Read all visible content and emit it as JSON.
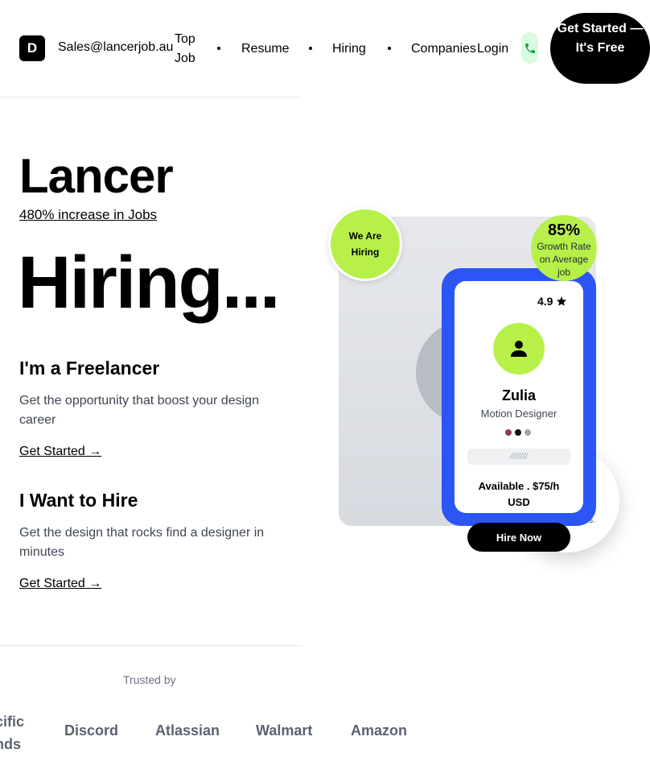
{
  "header": {
    "logo_letter": "D",
    "email": "Sales@lancerjob.au",
    "nav": [
      "Top Job",
      "Resume",
      "Hiring",
      "Companies"
    ],
    "login": "Login",
    "cta": "Get Started — It's Free"
  },
  "hero": {
    "title": "Lancer",
    "link": "480% increase in Jobs",
    "hiring": "Hiring..."
  },
  "blocks": [
    {
      "title": "I'm a Freelancer",
      "desc": "Get the opportunity that boost your design career",
      "link": "Get Started →"
    },
    {
      "title": "I Want to Hire",
      "desc": "Get the design that rocks find a designer in minutes",
      "link": "Get Started →"
    }
  ],
  "trusted": {
    "label": "Trusted by",
    "brands": [
      "cific nds",
      "Discord",
      "Atlassian",
      "Walmart",
      "Amazon"
    ]
  },
  "visual": {
    "badge_hiring": "We Are Hiring",
    "stat_value": "85%",
    "stat_label": "Growth Rate on Average job",
    "users_text": "ers."
  },
  "profile": {
    "rating": "4.9",
    "name": "Zulia",
    "role": "Motion Designer",
    "skills_placeholder": "///////",
    "availability": "Available . $75/h USD",
    "hire_button": "Hire Now",
    "dot_colors": [
      "#8b3a5a",
      "#111111",
      "#a0a4ad"
    ]
  },
  "colors": {
    "accent_lime": "#b8f04a",
    "accent_blue": "#2b56f5",
    "phone_bg": "#d9fbe0",
    "phone_icon": "#16a34a"
  }
}
